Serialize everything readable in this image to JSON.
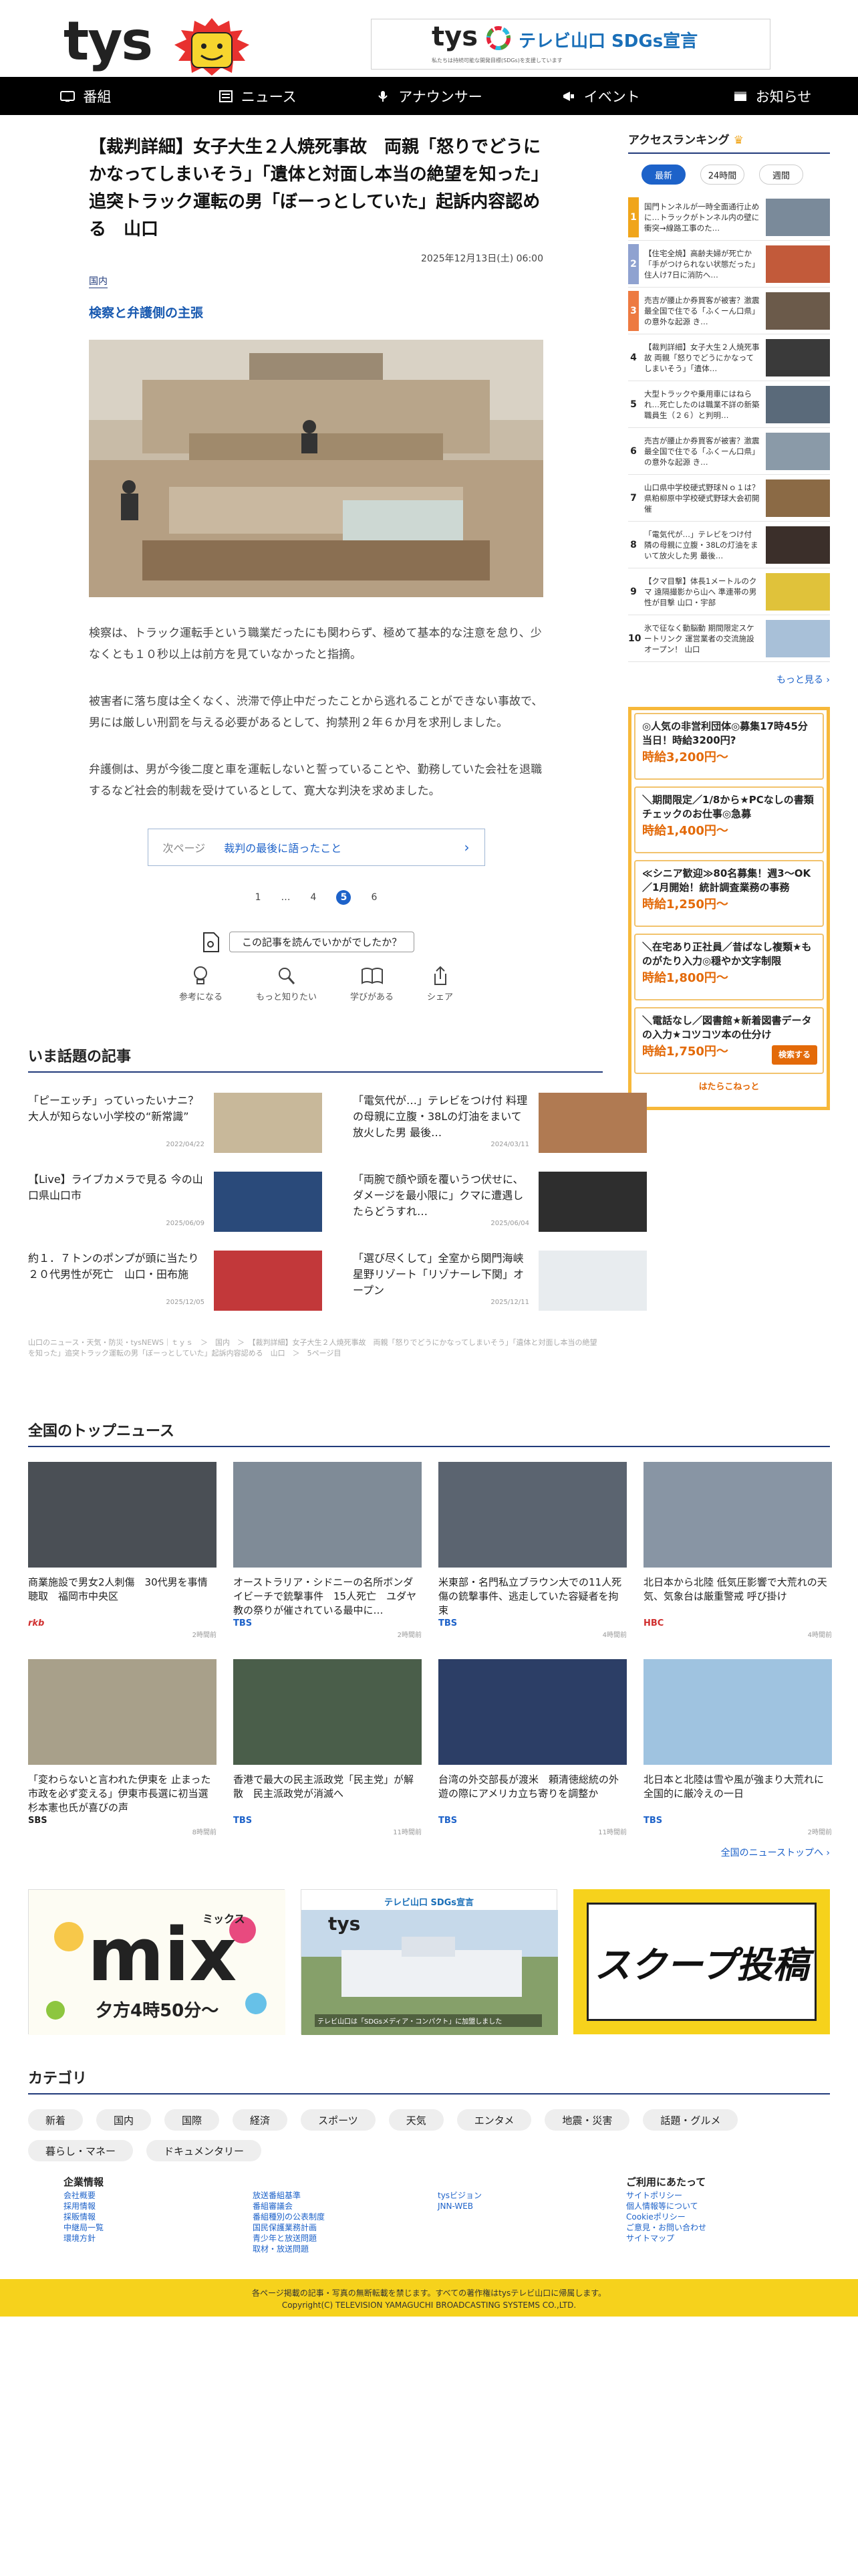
{
  "header": {
    "logo": "tys",
    "sdgs_logo": "tys",
    "sdgs_title": "テレビ山口 SDGs宣言",
    "sdgs_sub": "私たちは持続可能な開発目標(SDGs)を支援しています"
  },
  "nav": [
    {
      "label": "番組",
      "icon": "tv-icon"
    },
    {
      "label": "ニュース",
      "icon": "news-icon"
    },
    {
      "label": "アナウンサー",
      "icon": "microphone-icon"
    },
    {
      "label": "イベント",
      "icon": "megaphone-icon"
    },
    {
      "label": "お知らせ",
      "icon": "notice-icon"
    }
  ],
  "article": {
    "title": "【裁判詳細】女子大生２人焼死事故　両親「怒りでどうにかなってしまいそう」「遺体と対面し本当の絶望を知った」追突トラック運転の男「ぼーっとしていた」起訴内容認める　山口",
    "date": "2025年12月13日(土) 06:00",
    "category": "国内",
    "subhead": "検察と弁護側の主張",
    "paragraphs": [
      "検察は、トラック運転手という職業だったにも関わらず、極めて基本的な注意を怠り、少なくとも１０秒以上は前方を見ていなかったと指摘。",
      "被害者に落ち度は全くなく、渋滞で停止中だったことから逃れることができない事故で、男には厳しい刑罰を与える必要があるとして、拘禁刑２年６か月を求刑しました。",
      "弁護側は、男が今後二度と車を運転しないと誓っていることや、勤務していた会社を退職するなど社会的制裁を受けているとして、寛大な判決を求めました。"
    ],
    "next_label": "次ページ",
    "next_title": "裁判の最後に語ったこと",
    "pages": [
      "1",
      "…",
      "4",
      "5",
      "6"
    ],
    "current_page": "5",
    "reaction_question": "この記事を読んでいかがでしたか？",
    "reactions": [
      {
        "label": "参考になる",
        "icon": "lightbulb-icon"
      },
      {
        "label": "もっと知りたい",
        "icon": "magnifier-icon"
      },
      {
        "label": "学びがある",
        "icon": "book-icon"
      },
      {
        "label": "シェア",
        "icon": "share-icon"
      }
    ]
  },
  "ranking": {
    "title": "アクセスランキング",
    "tabs": [
      "最新",
      "24時間",
      "週間"
    ],
    "items": [
      {
        "rank": "1",
        "text": "国門トンネルが一時全面通行止めに…トラックがトンネル内の壁に衝突→線路工事のた…",
        "color": "#f0a51b"
      },
      {
        "rank": "2",
        "text": "【住宅全焼】高齢夫婦が死亡か「手がつけられない状態だった」住人け7日に消防へ…",
        "color": "#8fa2d0"
      },
      {
        "rank": "3",
        "text": "売吉が腰止か券買客が被害？激震最全国で住でる「ふくーん口県」の意外な起源 き…",
        "color": "#ed7a41"
      },
      {
        "rank": "4",
        "text": "【裁判詳細】女子大生２人焼死事故 両親「怒りでどうにかなってしまいそう」「遺体…",
        "color": ""
      },
      {
        "rank": "5",
        "text": "大型トラックや乗用車にはねられ…死亡したのは職業不詳の新築職員生（２６）と判明…",
        "color": ""
      },
      {
        "rank": "6",
        "text": "売吉が腰止か券買客が被害？激震最全国で住でる「ふくーん口県」の意外な起源 き…",
        "color": ""
      },
      {
        "rank": "7",
        "text": "山口県中学校硬式野球Ｎｏ１は？ 県粕柳原中学校硬式野球大会初開催",
        "color": ""
      },
      {
        "rank": "8",
        "text": "「電気代が…」テレビをつけ付 隣の母親に立腹・38Lの灯油をまいて放火した男 最後…",
        "color": ""
      },
      {
        "rank": "9",
        "text": "【クマ目撃】体長1メートルのクマ 遠隔撮影から山へ 準連帯の男性が目撃 山口・宇部",
        "color": ""
      },
      {
        "rank": "10",
        "text": "氷で征なく動脳動 期間限定スケートリンク 運営業者の交流施設オープン！ 山口",
        "color": ""
      }
    ],
    "more": "もっと見る ›"
  },
  "ad": {
    "items": [
      {
        "text": "◎人気の非営利団体◎募集17時45分当日！時給3200円?",
        "price": "時給3,200円〜"
      },
      {
        "text": "＼期間限定／1/8から★PCなしの書類チェックのお仕事◎急募",
        "price": "時給1,400円〜"
      },
      {
        "text": "≪シニア歓迎≫80名募集！週3〜OK／1月開始！統計調査業務の事務",
        "price": "時給1,250円〜"
      },
      {
        "text": "＼在宅あり正社員／昔ばなし複類★ものがたり入力◎穏やか文字制限",
        "price": "時給1,800円〜"
      },
      {
        "text": "＼電話なし／図書館★新着図書データの入力★コツコツ本の仕分け",
        "price": "時給1,750円〜"
      }
    ],
    "apply": "検索する",
    "brand": "はたらこねっと"
  },
  "wadai": {
    "title": "いま話題の記事",
    "items": [
      {
        "text": "「ピーエッチ」っていったいナニ？大人が知らない小学校の“新常識”",
        "date": "2022/04/22"
      },
      {
        "text": "「電気代が…」テレビをつけ付 料理の母親に立腹・38Lの灯油をまいて放火した男 最後…",
        "date": "2024/03/11"
      },
      {
        "text": "【Live】ライブカメラで見る 今の山口県山口市",
        "date": "2025/06/09"
      },
      {
        "text": "「両腕で顔や頭を覆いうつ伏せに、ダメージを最小限に」クマに遭遇したらどうすれ…",
        "date": "2025/06/04"
      },
      {
        "text": "約１．７トンのポンプが頭に当たり２０代男性が死亡　山口・田布施",
        "date": "2025/12/05"
      },
      {
        "text": "「選び尽くして」全室から関門海峡　星野リゾート「リゾナーレ下関」オープン",
        "date": "2025/12/11"
      }
    ]
  },
  "breadcrumb": "山口のニュース・天気・防災・tysNEWS｜ｔｙｓ　＞　国内　＞　【裁判詳細】女子大生２人焼死事故　両親「怒りでどうにかなってしまいそう」「遺体と対面し本当の絶望を知った」追突トラック運転の男「ぼーっとしていた」起訴内容認める　山口　＞　5ページ目",
  "topnews": {
    "title": "全国のトップニュース",
    "items": [
      {
        "text": "商業施設で男女2人刺傷　30代男を事情聴取　福岡市中央区",
        "src": "rkb",
        "time": "2時間前"
      },
      {
        "text": "オーストラリア・シドニーの名所ボンダイビーチで銃撃事件　15人死亡　ユダヤ教の祭りが催されている最中に…",
        "src": "TBS",
        "time": "2時間前"
      },
      {
        "text": "米東部・名門私立ブラウン大での11人死傷の銃撃事件、逃走していた容疑者を拘束",
        "src": "TBS",
        "time": "4時間前"
      },
      {
        "text": "北日本から北陸 低気圧影響で大荒れの天気、気象台は厳重警戒 呼び掛け",
        "src": "HBC",
        "time": "4時間前"
      },
      {
        "text": "「変わらないと言われた伊東を 止まった市政を必ず変える」伊東市長選に初当選 杉本憲也氏が喜びの声",
        "src": "SBS",
        "time": "8時間前"
      },
      {
        "text": "香港で最大の民主派政党「民主党」が解散　民主派政党が消滅へ",
        "src": "TBS",
        "time": "11時間前"
      },
      {
        "text": "台湾の外交部長が渡米　頼清徳総統の外遊の際にアメリカ立ち寄りを調整か",
        "src": "TBS",
        "time": "11時間前"
      },
      {
        "text": "北日本と北陸は雪や風が強まり大荒れに　全国的に厳冷えの一日",
        "src": "TBS",
        "time": "2時間前"
      }
    ],
    "more": "全国のニューストップへ ›"
  },
  "banners": {
    "mix_title": "mix",
    "mix_sub": "ミックス",
    "mix_time": "夕方4時50分〜",
    "sdgs_label": "テレビ山口 SDGs宣言",
    "sdgs_caption": "テレビ山口は「SDGsメディア・コンパクト」に加盟しました",
    "scoop_title": "スクープ投稿"
  },
  "categories": {
    "title": "カテゴリ",
    "items": [
      "新着",
      "国内",
      "国際",
      "経済",
      "スポーツ",
      "天気",
      "エンタメ",
      "地震・災害",
      "話題・グルメ",
      "暮らし・マネー",
      "ドキュメンタリー"
    ]
  },
  "footer": {
    "col1_title": "企業情報",
    "col1": [
      "会社概要",
      "採用情報",
      "採販情報",
      "中継局一覧",
      "環境方針"
    ],
    "col2": [
      "放送番組基準",
      "番組審議会",
      "番組種別の公表制度",
      "国民保護業務計画",
      "青少年と放送問題",
      "取材・放送問題"
    ],
    "col3": [
      "tysビジョン",
      "JNN-WEB"
    ],
    "col4_title": "ご利用にあたって",
    "col4": [
      "サイトポリシー",
      "個人情報等について",
      "Cookieポリシー",
      "ご意見・お問い合わせ",
      "サイトマップ"
    ],
    "notice": "各ページ掲載の記事・写真の無断転載を禁じます。すべての著作権はtysテレビ山口に帰属します。",
    "copyright": "Copyright(C) TELEVISION YAMAGUCHI BROADCASTING SYSTEMS CO.,LTD."
  }
}
